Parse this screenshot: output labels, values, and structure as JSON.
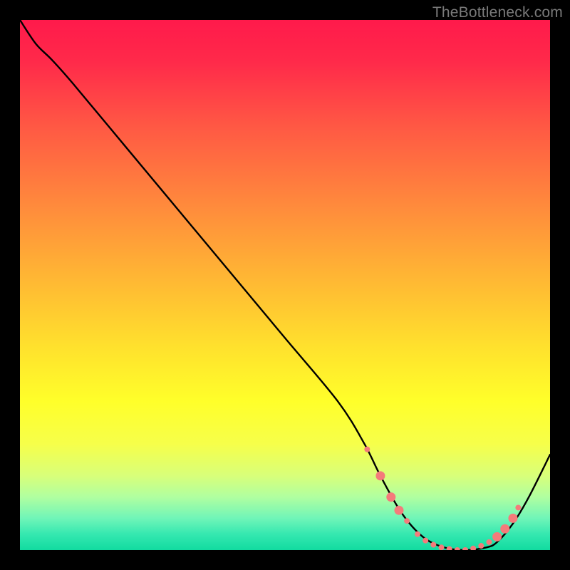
{
  "watermark": "TheBottleneck.com",
  "chart_data": {
    "type": "line",
    "title": "",
    "xlabel": "",
    "ylabel": "",
    "xlim": [
      0,
      100
    ],
    "ylim": [
      0,
      100
    ],
    "grid": false,
    "legend": false,
    "background_gradient_stops": [
      {
        "offset": 0.0,
        "color": "#ff1a4b"
      },
      {
        "offset": 0.08,
        "color": "#ff2a4a"
      },
      {
        "offset": 0.2,
        "color": "#ff5844"
      },
      {
        "offset": 0.35,
        "color": "#ff8a3c"
      },
      {
        "offset": 0.5,
        "color": "#ffbb33"
      },
      {
        "offset": 0.62,
        "color": "#ffe22d"
      },
      {
        "offset": 0.72,
        "color": "#ffff2a"
      },
      {
        "offset": 0.8,
        "color": "#f6ff4a"
      },
      {
        "offset": 0.86,
        "color": "#d8ff7a"
      },
      {
        "offset": 0.9,
        "color": "#b0ffa0"
      },
      {
        "offset": 0.94,
        "color": "#70f5b8"
      },
      {
        "offset": 0.97,
        "color": "#35e8b0"
      },
      {
        "offset": 1.0,
        "color": "#12dba0"
      }
    ],
    "series": [
      {
        "name": "bottleneck-curve",
        "color": "#000000",
        "x": [
          0.0,
          3.0,
          6.0,
          10.0,
          20.0,
          30.0,
          40.0,
          50.0,
          60.0,
          65.0,
          68.0,
          72.0,
          76.0,
          80.0,
          84.0,
          88.0,
          90.0,
          93.0,
          96.0,
          100.0
        ],
        "values": [
          100.0,
          95.5,
          92.5,
          88.0,
          76.0,
          64.0,
          52.0,
          40.0,
          28.0,
          20.0,
          14.0,
          7.0,
          2.5,
          0.5,
          0.0,
          0.5,
          1.5,
          5.0,
          10.0,
          18.0
        ]
      }
    ],
    "scatter_points": {
      "name": "highlight-dots",
      "color": "#f47b7b",
      "radius_small": 4.0,
      "radius_large": 6.5,
      "points": [
        {
          "x": 65.5,
          "y": 19.0,
          "r": "small"
        },
        {
          "x": 68.0,
          "y": 14.0,
          "r": "large"
        },
        {
          "x": 70.0,
          "y": 10.0,
          "r": "large"
        },
        {
          "x": 71.5,
          "y": 7.5,
          "r": "large"
        },
        {
          "x": 73.0,
          "y": 5.5,
          "r": "small"
        },
        {
          "x": 75.0,
          "y": 3.0,
          "r": "small"
        },
        {
          "x": 76.5,
          "y": 1.8,
          "r": "small"
        },
        {
          "x": 78.0,
          "y": 1.0,
          "r": "small"
        },
        {
          "x": 79.5,
          "y": 0.5,
          "r": "small"
        },
        {
          "x": 81.0,
          "y": 0.2,
          "r": "small"
        },
        {
          "x": 82.5,
          "y": 0.0,
          "r": "small"
        },
        {
          "x": 84.0,
          "y": 0.0,
          "r": "small"
        },
        {
          "x": 85.5,
          "y": 0.3,
          "r": "small"
        },
        {
          "x": 87.0,
          "y": 0.8,
          "r": "small"
        },
        {
          "x": 88.5,
          "y": 1.5,
          "r": "small"
        },
        {
          "x": 90.0,
          "y": 2.5,
          "r": "large"
        },
        {
          "x": 91.5,
          "y": 4.0,
          "r": "large"
        },
        {
          "x": 93.0,
          "y": 6.0,
          "r": "large"
        },
        {
          "x": 94.0,
          "y": 8.0,
          "r": "small"
        }
      ]
    }
  }
}
